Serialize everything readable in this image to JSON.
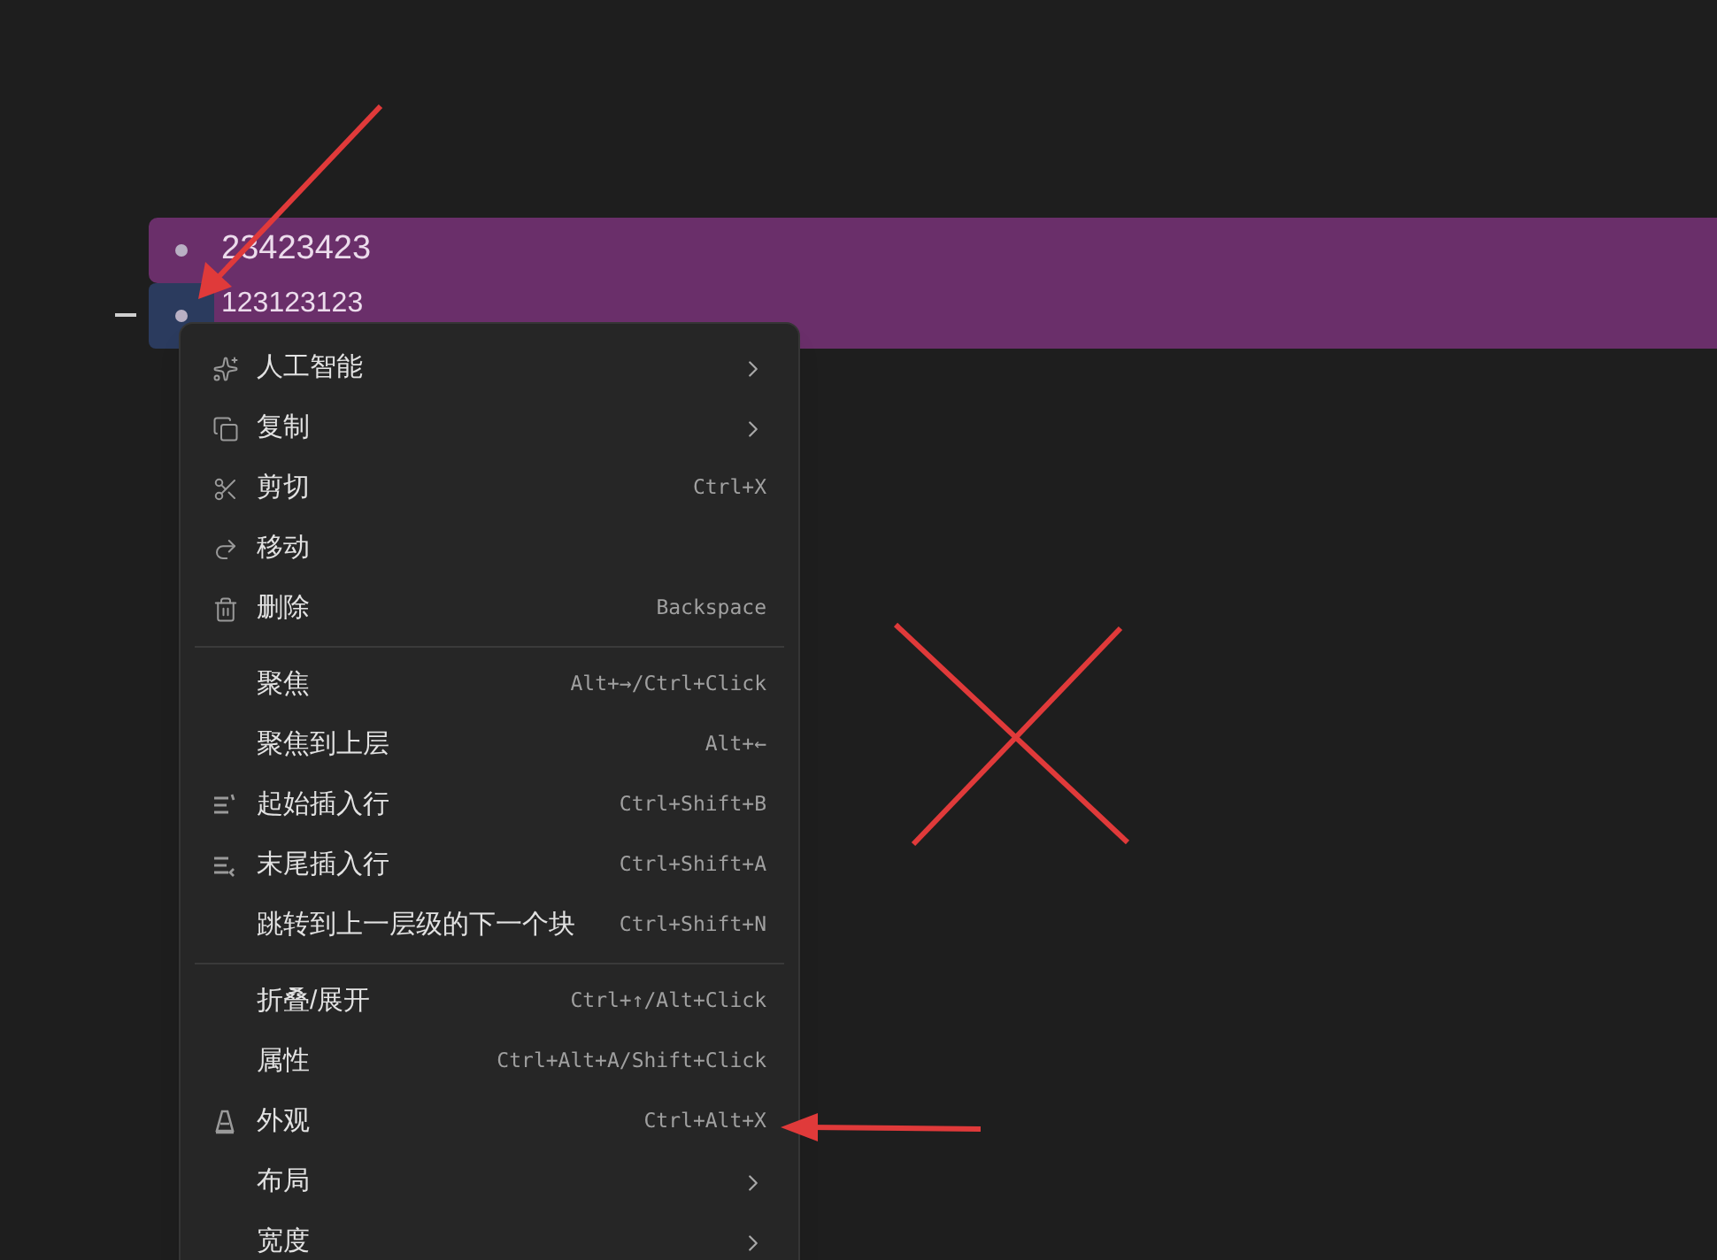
{
  "blocks": [
    {
      "text": "23423423",
      "selected": false
    },
    {
      "text": "123123123",
      "selected": true
    }
  ],
  "context_menu": {
    "groups": [
      [
        {
          "label": "人工智能",
          "submenu": true
        },
        {
          "label": "复制",
          "submenu": true
        },
        {
          "label": "剪切",
          "shortcut": "Ctrl+X",
          "submenu": false
        },
        {
          "label": "移动",
          "submenu": false
        },
        {
          "label": "删除",
          "shortcut": "Backspace",
          "submenu": false
        }
      ],
      [
        {
          "label": "聚焦",
          "shortcut": "Alt+→/Ctrl+Click",
          "submenu": false
        },
        {
          "label": "聚焦到上层",
          "shortcut": "Alt+←",
          "submenu": false
        },
        {
          "label": "起始插入行",
          "shortcut": "Ctrl+Shift+B",
          "submenu": false
        },
        {
          "label": "末尾插入行",
          "shortcut": "Ctrl+Shift+A",
          "submenu": false
        },
        {
          "label": "跳转到上一层级的下一个块",
          "shortcut": "Ctrl+Shift+N",
          "submenu": false
        }
      ],
      [
        {
          "label": "折叠/展开",
          "shortcut": "Ctrl+↑/Alt+Click",
          "submenu": false
        },
        {
          "label": "属性",
          "shortcut": "Ctrl+Alt+A/Shift+Click",
          "submenu": false
        },
        {
          "label": "外观",
          "shortcut": "Ctrl+Alt+X",
          "submenu": false
        },
        {
          "label": "布局",
          "submenu": true
        },
        {
          "label": "宽度",
          "submenu": true
        }
      ]
    ]
  }
}
